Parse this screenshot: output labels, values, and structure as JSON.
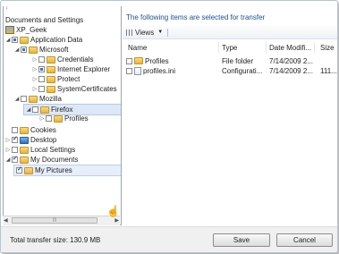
{
  "tree": {
    "top_item": "Documents and Settings",
    "items": [
      {
        "label": "XP_Geek"
      },
      {
        "label": "Application Data"
      },
      {
        "label": "Microsoft"
      },
      {
        "label": "Credentials"
      },
      {
        "label": "Internet Explorer"
      },
      {
        "label": "Protect"
      },
      {
        "label": "SystemCertificates"
      },
      {
        "label": "Mozilla"
      },
      {
        "label": "Firefox"
      },
      {
        "label": "Profiles"
      },
      {
        "label": "Cookies"
      },
      {
        "label": "Desktop"
      },
      {
        "label": "Local Settings"
      },
      {
        "label": "My Documents"
      },
      {
        "label": "My Pictures"
      }
    ],
    "scroll_thumb_label": "|||"
  },
  "main": {
    "heading": "The following items are selected for transfer",
    "toolbar": {
      "views_label": "Views",
      "views_arrow": "▼"
    },
    "columns": [
      "Name",
      "Type",
      "Date Modifi...",
      "Size"
    ],
    "rows": [
      {
        "name": "Profiles",
        "type": "File folder",
        "date": "7/14/2009 2...",
        "size": ""
      },
      {
        "name": "profiles.ini",
        "type": "Configurati...",
        "date": "7/14/2009 2...",
        "size": "111..."
      }
    ]
  },
  "footer": {
    "total_label": "Total transfer size: 130.9 MB",
    "save_label": "Save",
    "cancel_label": "Cancel"
  },
  "colors": {
    "accent": "#1d4f9c",
    "selection": "#dde8f6"
  }
}
